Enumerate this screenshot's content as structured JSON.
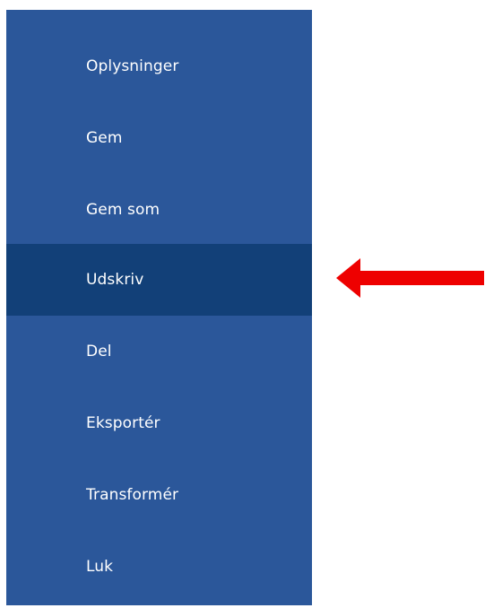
{
  "backstage_menu": {
    "items": [
      {
        "label": "Oplysninger"
      },
      {
        "label": "Gem"
      },
      {
        "label": "Gem som"
      },
      {
        "label": "Udskriv",
        "selected": true
      },
      {
        "label": "Del"
      },
      {
        "label": "Eksportér"
      },
      {
        "label": "Transformér"
      },
      {
        "label": "Luk"
      }
    ]
  },
  "colors": {
    "menu_background": "#2b579a",
    "selected_item_background": "#124078",
    "menu_text": "#ffffff",
    "annotation_arrow": "#ee0000"
  },
  "icons": {
    "annotation_arrow": "left-arrow-icon"
  }
}
